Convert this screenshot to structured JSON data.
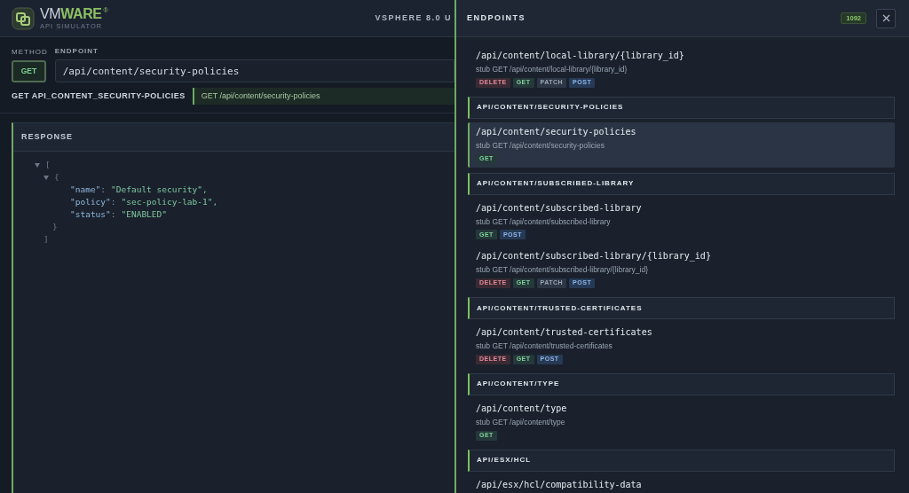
{
  "header": {
    "brand_main": "VM",
    "brand_accent": "WARE",
    "brand_mark": "®",
    "subtitle": "API SIMULATOR",
    "version": "VSPHERE 8.0 U"
  },
  "request": {
    "method_label": "METHOD",
    "method": "GET",
    "endpoint_label": "ENDPOINT",
    "endpoint": "/api/content/security-policies",
    "title": "GET API_CONTENT_SECURITY-POLICIES",
    "summary": "GET /api/content/security-policies"
  },
  "response": {
    "title": "RESPONSE",
    "tree": {
      "open": "[",
      "expanded": true,
      "close": "]",
      "children": [
        {
          "open": "{",
          "expanded": true,
          "close": "}",
          "children": [
            {
              "key": "\"name\"",
              "sep": ":",
              "value": "\"Default security\","
            },
            {
              "key": "\"policy\"",
              "sep": ":",
              "value": "\"sec-policy-lab-1\","
            },
            {
              "key": "\"status\"",
              "sep": ":",
              "value": "\"ENABLED\""
            }
          ]
        }
      ]
    }
  },
  "drawer": {
    "title": "ENDPOINTS",
    "count": "1092",
    "groups": [
      {
        "endpoints": [
          {
            "path": "/api/content/local-library/{library_id}",
            "summary": "stub GET /api/content/local-library/{library_id}",
            "selected": false,
            "methods": [
              {
                "label": "DELETE",
                "kind": "delete"
              },
              {
                "label": "GET",
                "kind": "get"
              },
              {
                "label": "PATCH",
                "kind": "patch"
              },
              {
                "label": "POST",
                "kind": "post"
              }
            ]
          }
        ]
      },
      {
        "heading": "API/CONTENT/SECURITY-POLICIES",
        "endpoints": [
          {
            "path": "/api/content/security-policies",
            "summary": "stub GET /api/content/security-policies",
            "selected": true,
            "methods": [
              {
                "label": "GET",
                "kind": "get"
              }
            ]
          }
        ]
      },
      {
        "heading": "API/CONTENT/SUBSCRIBED-LIBRARY",
        "endpoints": [
          {
            "path": "/api/content/subscribed-library",
            "summary": "stub GET /api/content/subscribed-library",
            "selected": false,
            "methods": [
              {
                "label": "GET",
                "kind": "get"
              },
              {
                "label": "POST",
                "kind": "post"
              }
            ]
          },
          {
            "path": "/api/content/subscribed-library/{library_id}",
            "summary": "stub GET /api/content/subscribed-library/{library_id}",
            "selected": false,
            "methods": [
              {
                "label": "DELETE",
                "kind": "delete"
              },
              {
                "label": "GET",
                "kind": "get"
              },
              {
                "label": "PATCH",
                "kind": "patch"
              },
              {
                "label": "POST",
                "kind": "post"
              }
            ]
          }
        ]
      },
      {
        "heading": "API/CONTENT/TRUSTED-CERTIFICATES",
        "endpoints": [
          {
            "path": "/api/content/trusted-certificates",
            "summary": "stub GET /api/content/trusted-certificates",
            "selected": false,
            "methods": [
              {
                "label": "DELETE",
                "kind": "delete"
              },
              {
                "label": "GET",
                "kind": "get"
              },
              {
                "label": "POST",
                "kind": "post"
              }
            ]
          }
        ]
      },
      {
        "heading": "API/CONTENT/TYPE",
        "endpoints": [
          {
            "path": "/api/content/type",
            "summary": "stub GET /api/content/type",
            "selected": false,
            "methods": [
              {
                "label": "GET",
                "kind": "get"
              }
            ]
          }
        ]
      },
      {
        "heading": "API/ESX/HCL",
        "endpoints": [
          {
            "path": "/api/esx/hcl/compatibility-data",
            "selected": false
          }
        ]
      }
    ]
  }
}
